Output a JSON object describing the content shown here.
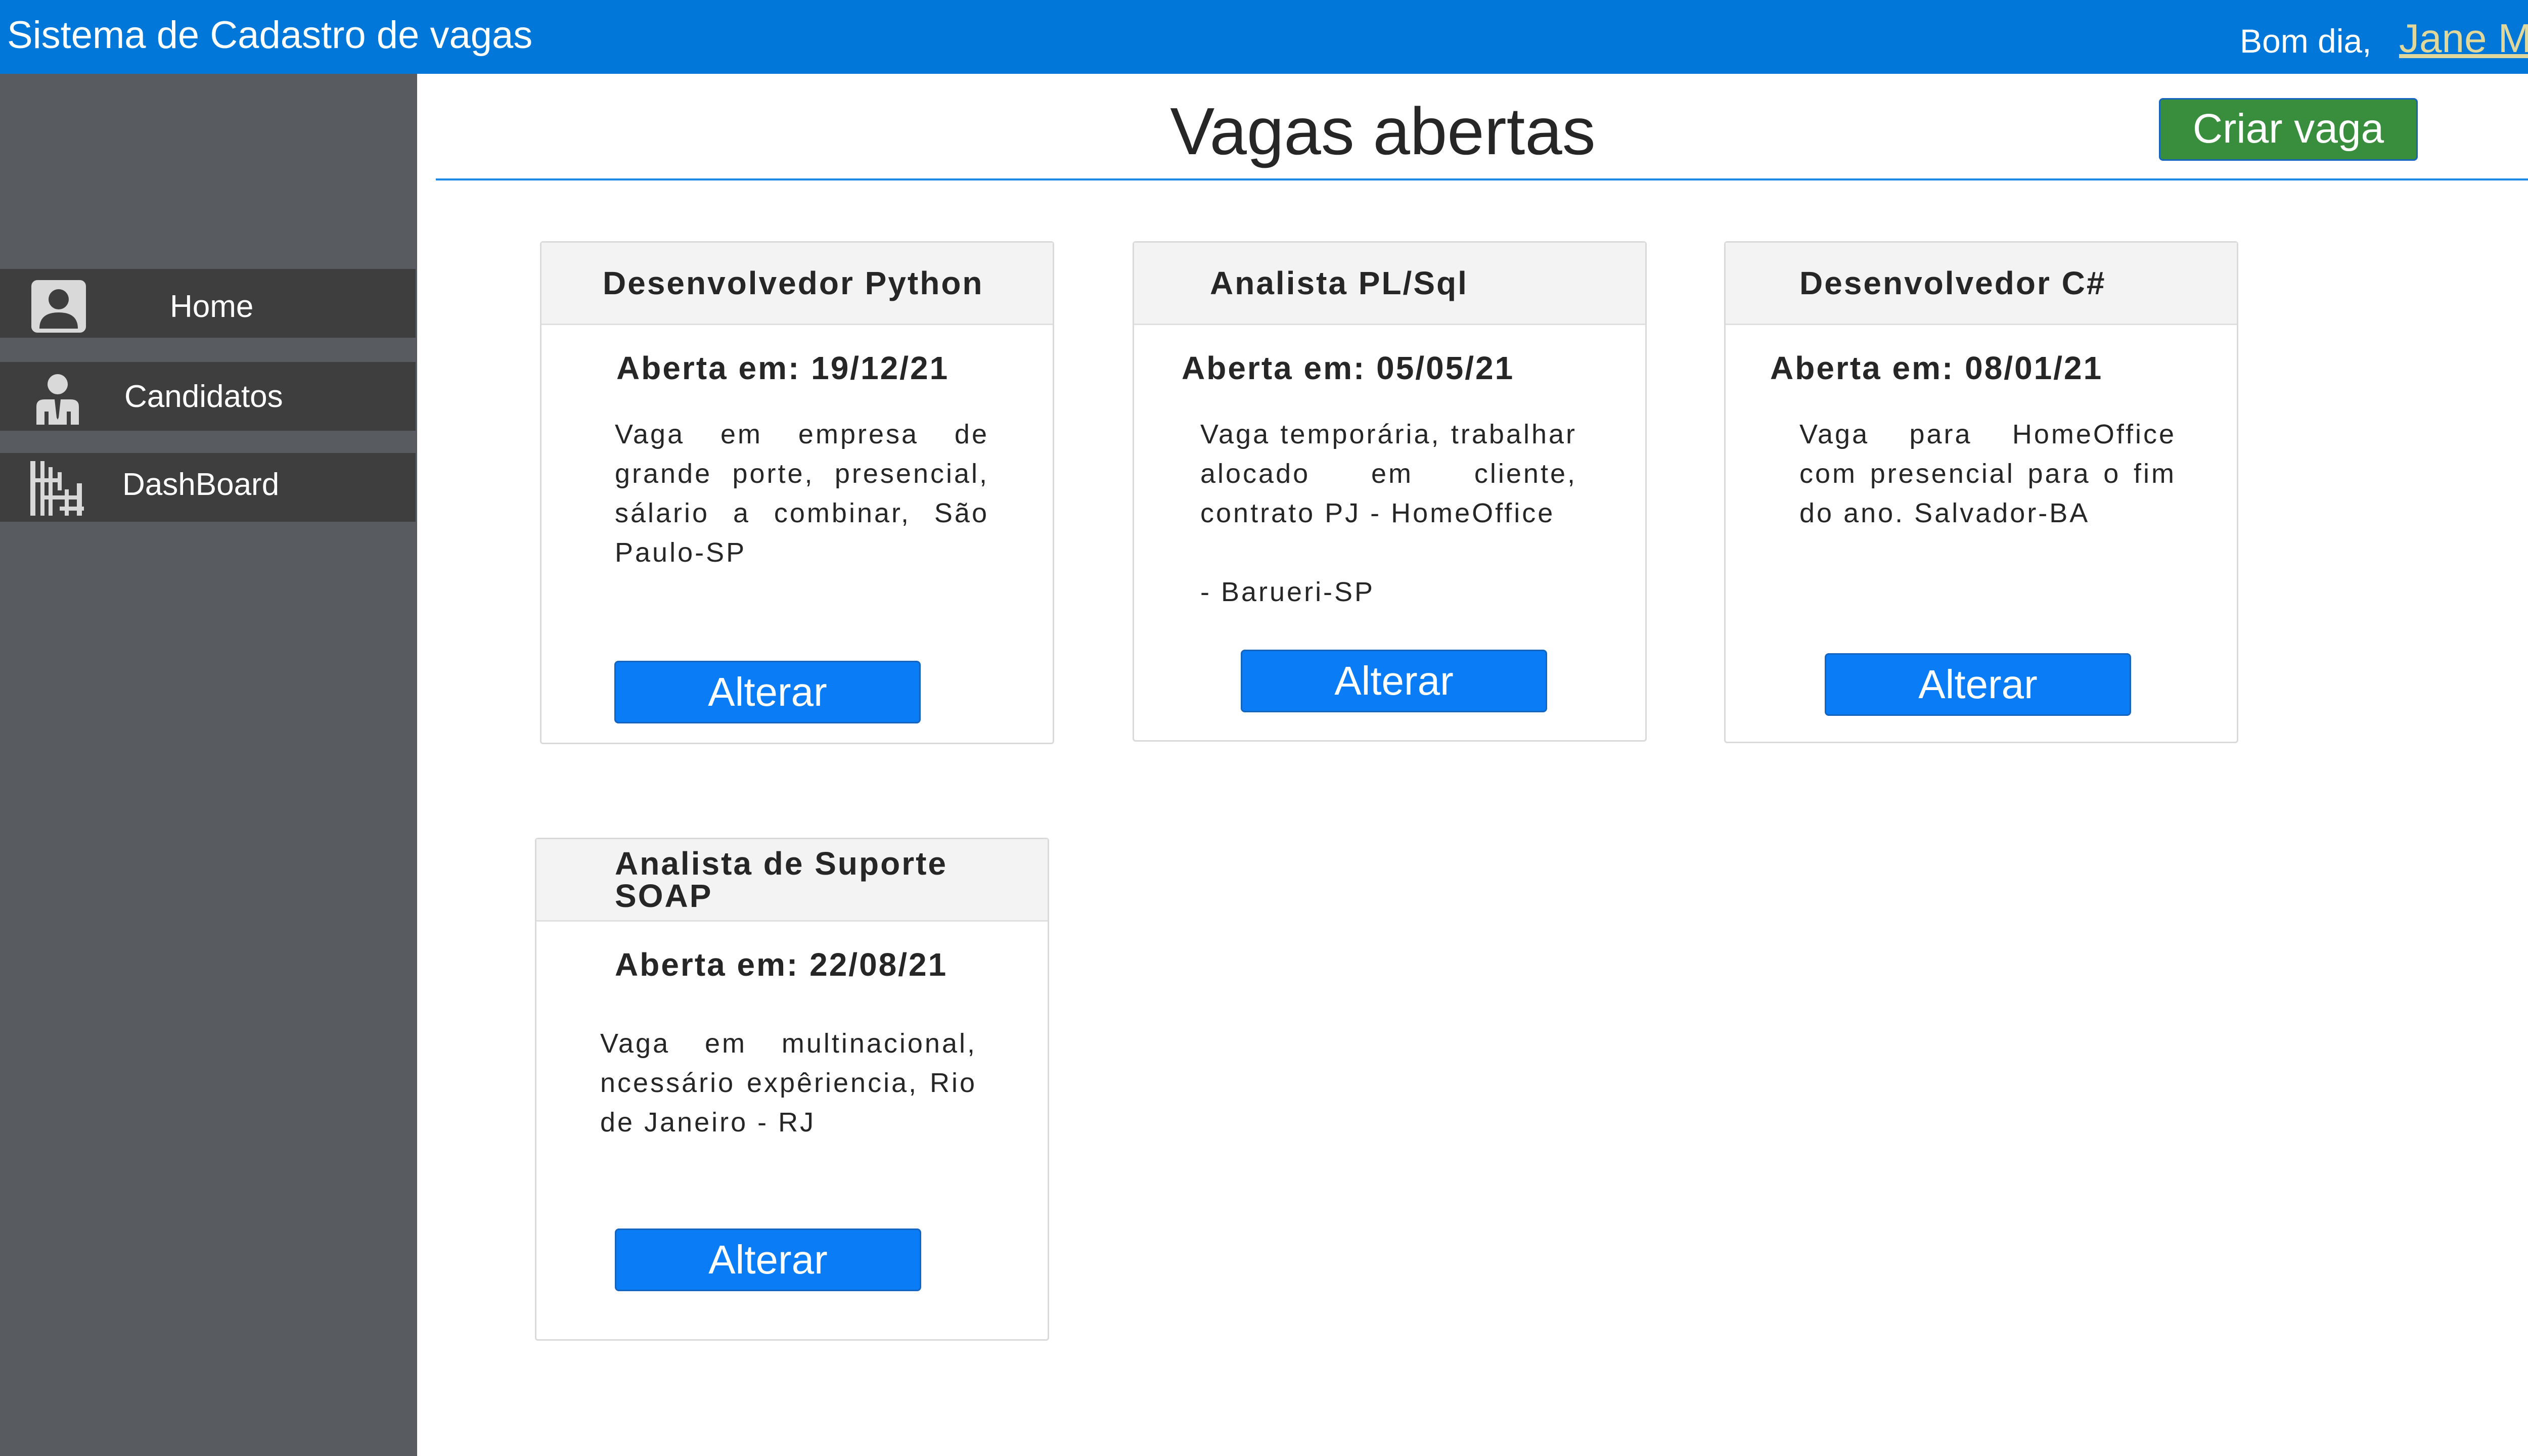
{
  "header": {
    "app_title": "Sistema de Cadastro de vagas",
    "greeting": "Bom dia,",
    "user_name": "Jane Mary"
  },
  "sidebar": {
    "items": [
      {
        "label": "Home",
        "icon": "user-card-icon"
      },
      {
        "label": "Candidatos",
        "icon": "person-icon"
      },
      {
        "label": "DashBoard",
        "icon": "dashboard-icon"
      }
    ]
  },
  "main": {
    "title": "Vagas abertas",
    "create_button": "Criar  vaga",
    "jobs": [
      {
        "title": "Desenvolvedor Python",
        "date": "Aberta em: 19/12/21",
        "description": "Vaga em empresa de grande porte, presencial, sálario a combinar, São Paulo-SP",
        "button": "Alterar"
      },
      {
        "title": "Analista PL/Sql",
        "date": "Aberta em: 05/05/21",
        "description": "Vaga temporária, trabalhar alocado em cliente, contrato PJ - HomeOffice",
        "description_extra": " -  Barueri-SP",
        "button": "Alterar"
      },
      {
        "title": "Desenvolvedor C#",
        "date": "Aberta em: 08/01/21",
        "description": "Vaga para HomeOffice com presencial para o fim do ano. Salvador-BA",
        "button": "Alterar"
      },
      {
        "title": "Analista de Suporte SOAP",
        "date": "Aberta em: 22/08/21",
        "description": "Vaga em multinacional, ncessário expêriencia, Rio de Janeiro - RJ",
        "button": "Alterar"
      }
    ]
  },
  "colors": {
    "header_bg": "#0077D9",
    "sidebar_bg": "#585C61",
    "nav_item_bg": "#3E3E3E",
    "accent_green": "#388E3C",
    "button_blue": "#0A7CF6",
    "user_name": "#E0D79B"
  }
}
